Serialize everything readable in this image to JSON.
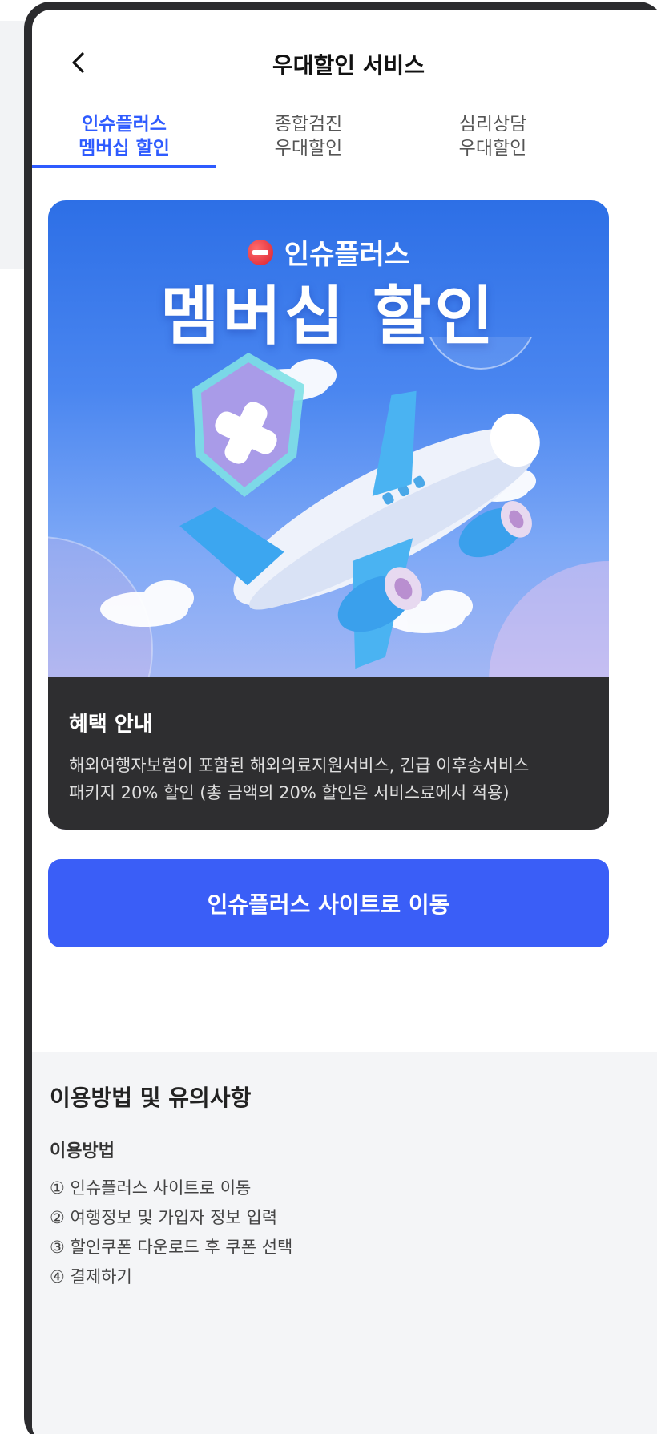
{
  "header": {
    "back_icon": "chevron-left-icon",
    "title": "우대할인 서비스"
  },
  "tabs": [
    {
      "line1": "인슈플러스",
      "line2": "멤버십 할인",
      "active": true
    },
    {
      "line1": "종합검진",
      "line2": "우대할인",
      "active": false
    },
    {
      "line1": "심리상담",
      "line2": "우대할인",
      "active": false
    }
  ],
  "banner": {
    "brand": "인슈플러스",
    "title": "멤버십 할인",
    "info_title": "혜택 안내",
    "info_line1": "해외여행자보험이 포함된 해외의료지원서비스, 긴급 이후송서비스",
    "info_line2": "패키지 20% 할인 (총 금액의 20% 할인은 서비스료에서 적용)"
  },
  "cta": {
    "label": "인슈플러스 사이트로 이동"
  },
  "notes": {
    "title": "이용방법 및 유의사항",
    "subtitle": "이용방법",
    "steps": [
      "① 인슈플러스 사이트로 이동",
      "② 여행정보 및 가입자 정보 입력",
      "③ 할인쿠폰 다운로드 후 쿠폰 선택",
      "④ 결제하기"
    ]
  },
  "colors": {
    "accent": "#2e5bff",
    "cta": "#3a5ef7",
    "info_bg": "#2e2e30"
  }
}
